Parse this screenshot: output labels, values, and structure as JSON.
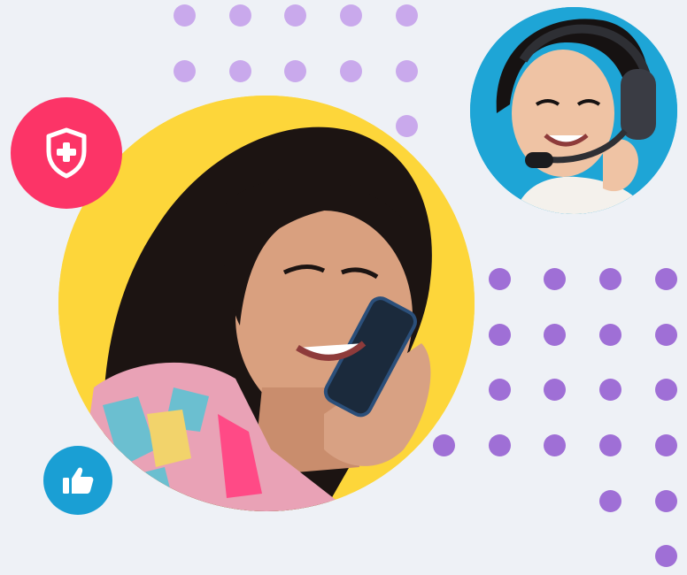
{
  "colors": {
    "background": "#eef1f6",
    "dot_light": "#c9a9ec",
    "dot_dark": "#9f6fd6",
    "main_photo_bg": "#fdd63a",
    "agent_photo_bg": "#1ea5d6",
    "shield_badge": "#fc3467",
    "like_badge": "#1a9fd4"
  },
  "images": {
    "main_photo": "woman-talking-on-phone",
    "agent_photo": "support-agent-with-headset"
  },
  "icons": {
    "shield": "shield-plus-icon",
    "like": "thumbs-up-icon"
  }
}
